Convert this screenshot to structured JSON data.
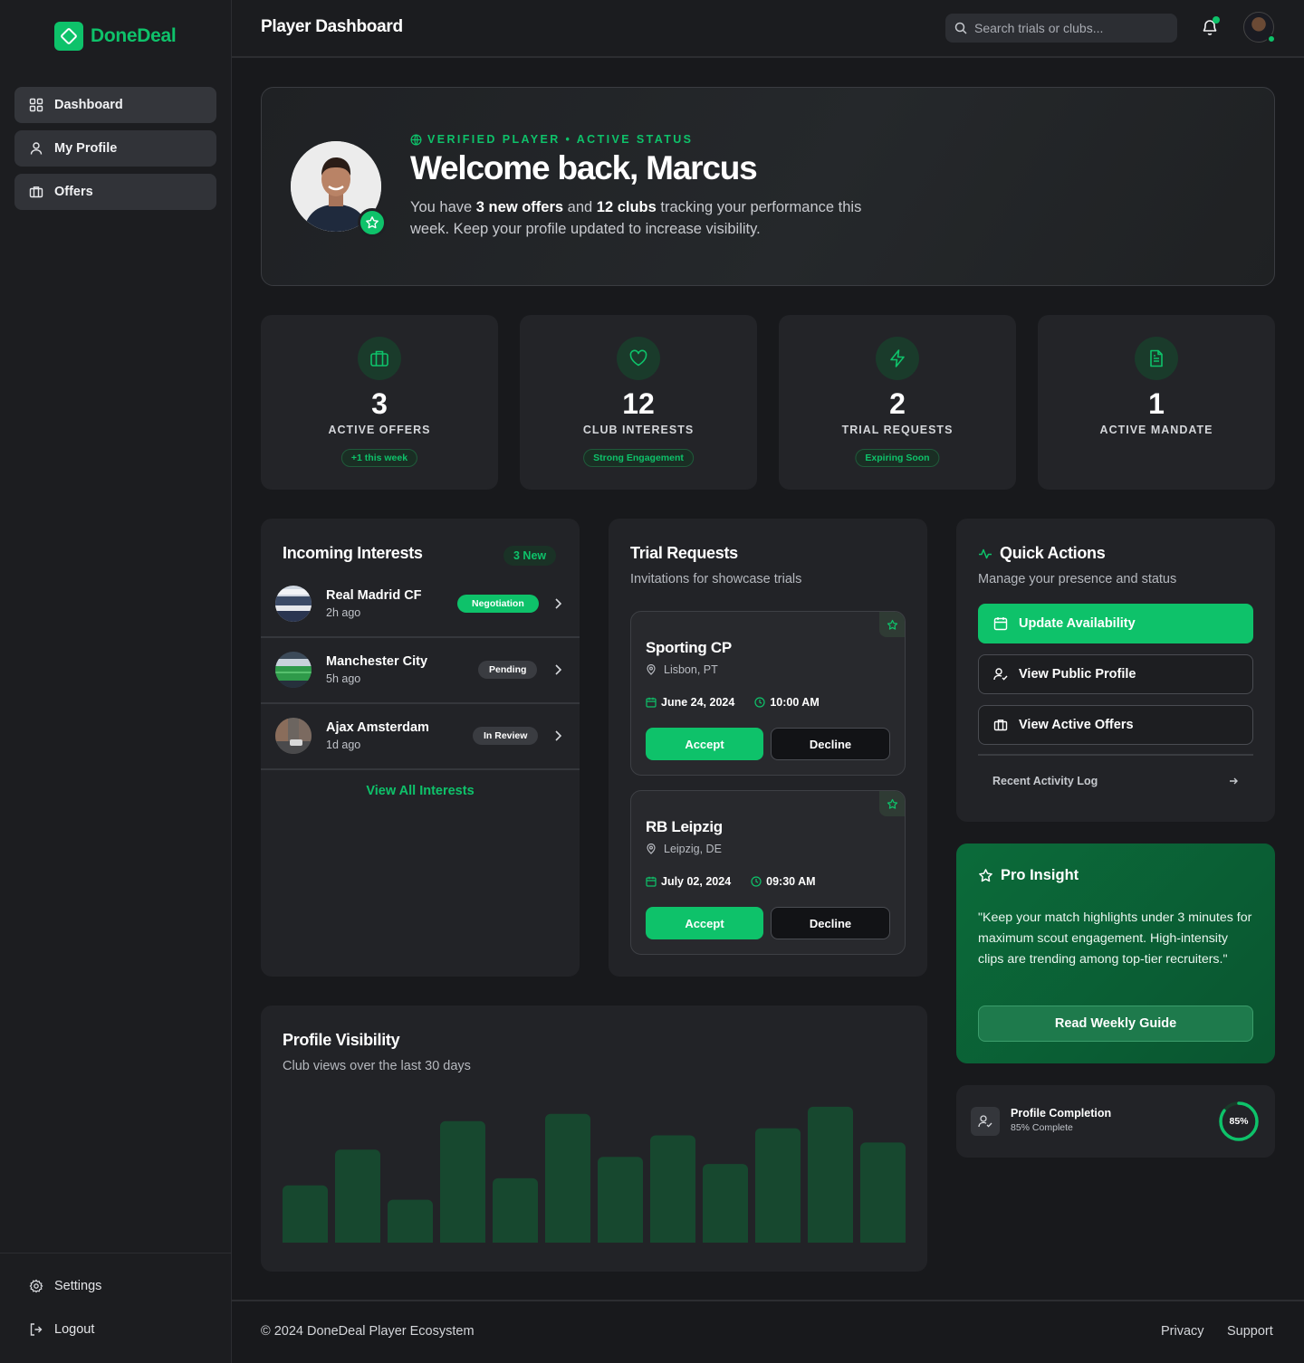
{
  "brand": {
    "name": "DoneDeal",
    "accent": "#0ec26a"
  },
  "sidebar": {
    "items": [
      {
        "label": "Dashboard",
        "icon": "grid-icon"
      },
      {
        "label": "My Profile",
        "icon": "user-icon"
      },
      {
        "label": "Offers",
        "icon": "briefcase-icon"
      }
    ],
    "settings_label": "Settings",
    "logout_label": "Logout"
  },
  "header": {
    "title": "Player Dashboard",
    "search_placeholder": "Search trials or clubs..."
  },
  "welcome": {
    "badge": "VERIFIED PLAYER • ACTIVE STATUS",
    "title": "Welcome back, Marcus",
    "text_1": "You have ",
    "offers_bold": "3 new offers",
    "text_2": " and ",
    "clubs_bold": "12 clubs",
    "text_3": " tracking your performance this week. Keep your profile updated to increase visibility."
  },
  "stats": [
    {
      "value": "3",
      "label": "ACTIVE OFFERS",
      "pill": "+1 this week",
      "icon": "briefcase-icon"
    },
    {
      "value": "12",
      "label": "CLUB INTERESTS",
      "pill": "Strong Engagement",
      "icon": "heart-icon"
    },
    {
      "value": "2",
      "label": "TRIAL REQUESTS",
      "pill": "Expiring Soon",
      "icon": "lightning-icon"
    },
    {
      "value": "1",
      "label": "ACTIVE MANDATE",
      "pill": "",
      "icon": "document-icon"
    }
  ],
  "interests": {
    "title": "Incoming Interests",
    "new_badge": "3 New",
    "rows": [
      {
        "club": "Real Madrid CF",
        "time": "2h ago",
        "status": "Negotiation",
        "status_color": "#0ec26a"
      },
      {
        "club": "Manchester City",
        "time": "5h ago",
        "status": "Pending",
        "status_color": "#3a3c41"
      },
      {
        "club": "Ajax Amsterdam",
        "time": "1d ago",
        "status": "In Review",
        "status_color": "#3a3c41"
      }
    ],
    "view_all": "View All Interests"
  },
  "trials": {
    "title": "Trial Requests",
    "subtitle": "Invitations for showcase trials",
    "items": [
      {
        "club": "Sporting CP",
        "location": "Lisbon, PT",
        "date": "June 24, 2024",
        "time": "10:00 AM"
      },
      {
        "club": "RB Leipzig",
        "location": "Leipzig, DE",
        "date": "July 02, 2024",
        "time": "09:30 AM"
      }
    ],
    "accept_label": "Accept",
    "decline_label": "Decline"
  },
  "quick_actions": {
    "title": "Quick Actions",
    "subtitle": "Manage your presence and status",
    "buttons": [
      {
        "label": "Update Availability",
        "icon": "calendar-icon"
      },
      {
        "label": "View Public Profile",
        "icon": "user-check-icon"
      },
      {
        "label": "View Active Offers",
        "icon": "briefcase-icon"
      }
    ],
    "activity_log": "Recent Activity Log"
  },
  "insight": {
    "title": "Pro Insight",
    "text": "\"Keep your match highlights under 3 minutes for maximum scout engagement. High-intensity clips are trending among top-tier recruiters.\"",
    "button": "Read Weekly Guide"
  },
  "completion": {
    "title": "Profile Completion",
    "subtitle": "85% Complete",
    "percent_label": "85%",
    "percent": 85
  },
  "visibility": {
    "title": "Profile Visibility",
    "subtitle": "Club views over the last 30 days"
  },
  "chart_data": {
    "type": "bar",
    "categories": [],
    "values": [
      40,
      65,
      30,
      85,
      45,
      90,
      60,
      75,
      55,
      80,
      95,
      70
    ],
    "ylim": [
      0,
      100
    ],
    "grid": false,
    "color": "#17482f"
  },
  "footer": {
    "copyright": "© 2024 DoneDeal Player Ecosystem",
    "privacy": "Privacy",
    "support": "Support"
  }
}
